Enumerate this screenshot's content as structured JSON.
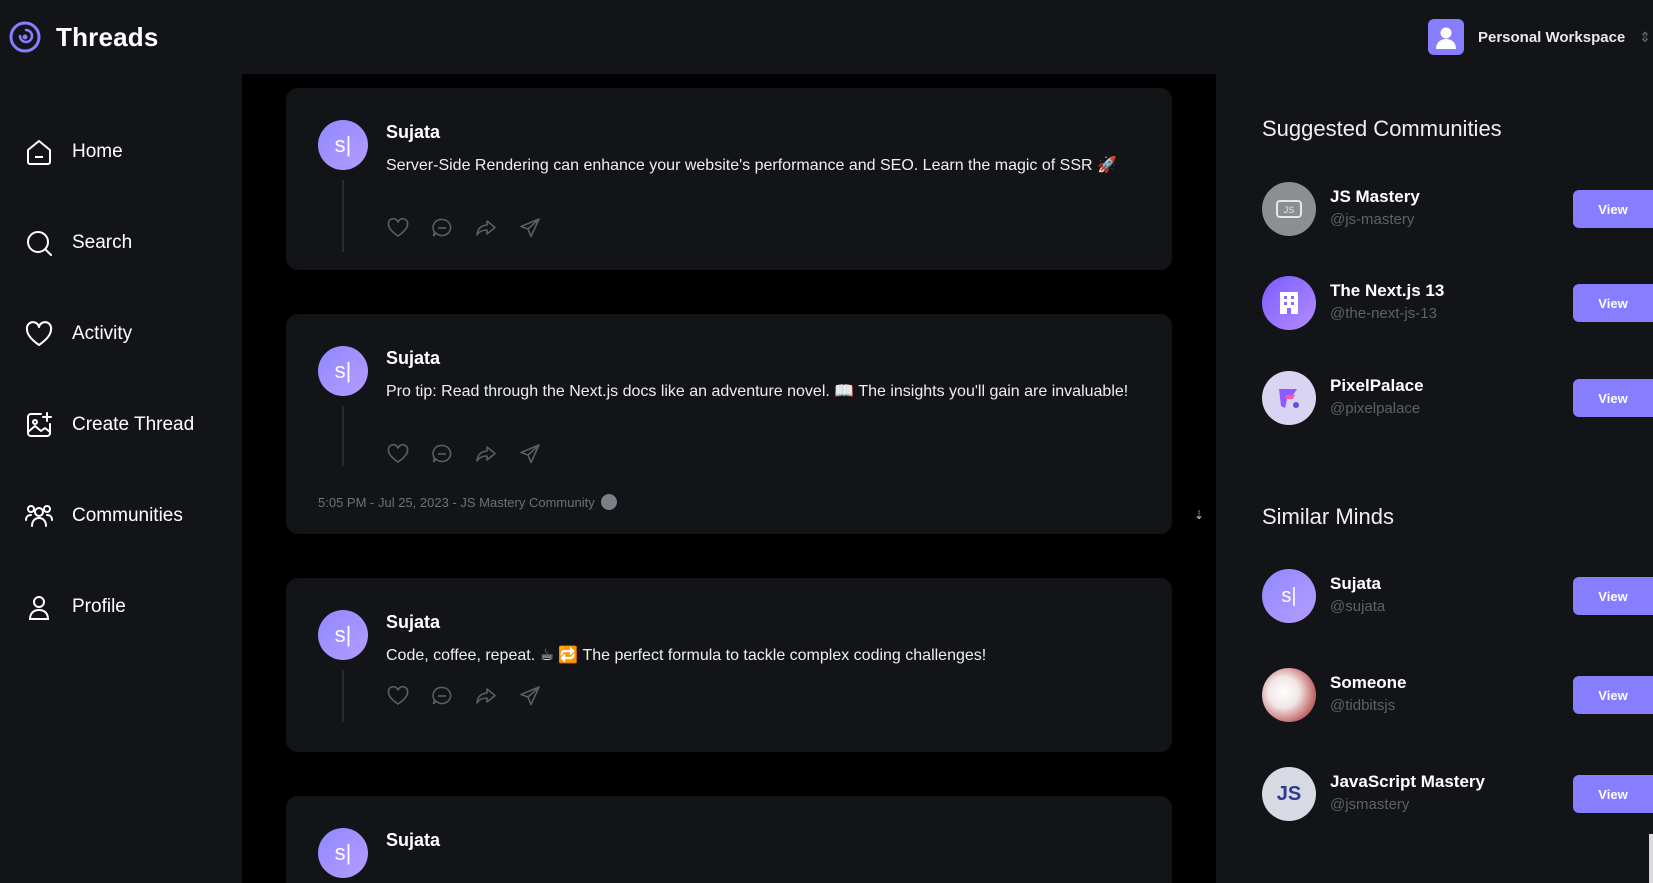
{
  "app": {
    "title": "Threads",
    "workspace_label": "Personal Workspace"
  },
  "colors": {
    "background": "#121417",
    "feed_background": "#000000",
    "accent": "#877eff",
    "text_muted": "#5f6069"
  },
  "nav": {
    "items": [
      {
        "label": "Home",
        "icon": "home-icon"
      },
      {
        "label": "Search",
        "icon": "search-icon"
      },
      {
        "label": "Activity",
        "icon": "heart-icon"
      },
      {
        "label": "Create Thread",
        "icon": "create-thread-icon"
      },
      {
        "label": "Communities",
        "icon": "users-icon"
      },
      {
        "label": "Profile",
        "icon": "user-icon"
      }
    ]
  },
  "feed": {
    "threads": [
      {
        "author": "Sujata",
        "avatar_text": "s|",
        "text": "Server-Side Rendering can enhance your website's performance and SEO. Learn the magic of SSR 🚀",
        "meta": ""
      },
      {
        "author": "Sujata",
        "avatar_text": "s|",
        "text": "Pro tip: Read through the Next.js docs like an adventure novel. 📖 The insights you'll gain are invaluable!",
        "meta": "5:05 PM - Jul 25, 2023 - JS Mastery Community"
      },
      {
        "author": "Sujata",
        "avatar_text": "s|",
        "text": "Code, coffee, repeat. ☕ 🔁 The perfect formula to tackle complex coding challenges!",
        "meta": ""
      },
      {
        "author": "Sujata",
        "avatar_text": "s|",
        "text": "",
        "meta": ""
      }
    ],
    "action_icons": [
      "heart-icon",
      "reply-icon",
      "repost-icon",
      "share-icon"
    ]
  },
  "right": {
    "suggested_title": "Suggested Communities",
    "similar_title": "Similar Minds",
    "view_label": "View",
    "communities": [
      {
        "name": "JS Mastery",
        "handle": "@js-mastery",
        "avatar_color": "#8a8f94"
      },
      {
        "name": "The Next.js 13",
        "handle": "@the-next-js-13",
        "avatar_color": "#8b6cff"
      },
      {
        "name": "PixelPalace",
        "handle": "@pixelpalace",
        "avatar_color": "#d9d4f2"
      }
    ],
    "minds": [
      {
        "name": "Sujata",
        "handle": "@sujata",
        "avatar_text": "s|",
        "avatar_color": "#8f88ff"
      },
      {
        "name": "Someone",
        "handle": "@tidbitsjs",
        "avatar_text": "",
        "avatar_color": "#c9a6a6"
      },
      {
        "name": "JavaScript Mastery",
        "handle": "@jsmastery",
        "avatar_text": "JS",
        "avatar_color": "#d7d9e3"
      }
    ]
  }
}
